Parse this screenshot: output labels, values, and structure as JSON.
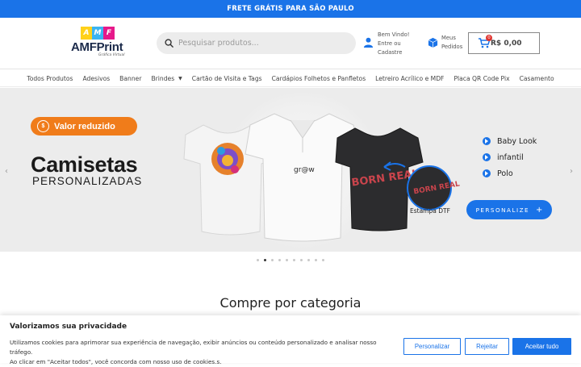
{
  "topbar": {
    "text": "FRETE GRÁTIS PARA SÃO PAULO"
  },
  "logo": {
    "letters": [
      "A",
      "M",
      "F"
    ],
    "letter_colors": [
      "#ffd11a",
      "#3ab4f2",
      "#e6198a"
    ],
    "wordmark": "AMFPrint",
    "tagline": "Gráfica Virtual"
  },
  "search": {
    "placeholder": "Pesquisar produtos..."
  },
  "account": {
    "line1": "Bem Vindo!",
    "line2": "Entre ou",
    "line3": "Cadastre"
  },
  "orders": {
    "line1": "Meus",
    "line2": "Pedidos"
  },
  "cart": {
    "count": "0",
    "total": "R$ 0,00"
  },
  "nav": [
    {
      "label": "Todos Produtos"
    },
    {
      "label": "Adesivos"
    },
    {
      "label": "Banner"
    },
    {
      "label": "Brindes"
    },
    {
      "label": "Cartão de Visita e Tags"
    },
    {
      "label": "Cardápios Folhetos e Panfletos"
    },
    {
      "label": "Letreiro Acrílico e MDF"
    },
    {
      "label": "Placa QR Code Pix"
    },
    {
      "label": "Casamento"
    }
  ],
  "hero": {
    "badge": "Valor reduzido",
    "title": "Camisetas",
    "subtitle": "PERSONALIZADAS",
    "options": [
      "Baby Look",
      "infantil",
      "Polo"
    ],
    "cta": "PERSONALIZE",
    "callout": "Estampa DTF",
    "shirt_logo": "gr@w",
    "shirt_print": "BORN REAL"
  },
  "slider": {
    "total": 10,
    "active": 1
  },
  "section": {
    "title": "Compre por categoria"
  },
  "cookie": {
    "title": "Valorizamos sua privacidade",
    "line1": "Utilizamos cookies para aprimorar sua experiência de navegação, exibir anúncios ou conteúdo personalizado e analisar nosso tráfego.",
    "line2": "Ao clicar em \"Aceitar todos\", você concorda com nosso uso de cookies.s.",
    "customize": "Personalizar",
    "reject": "Rejeitar",
    "accept": "Aceitar tudo"
  },
  "colors": {
    "accent": "#1a73e8",
    "badge": "#f07c1a",
    "cart_badge": "#e0332e"
  }
}
